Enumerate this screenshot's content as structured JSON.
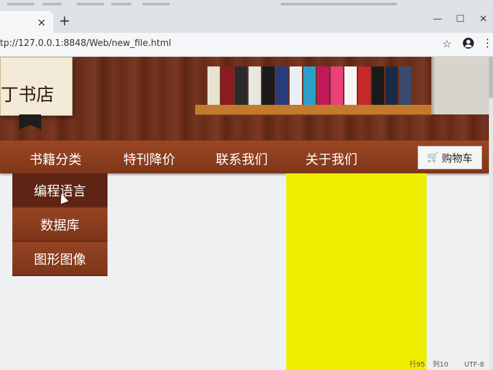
{
  "browser": {
    "tab_close_glyph": "×",
    "new_tab_glyph": "+",
    "url": "tp://127.0.0.1:8848/Web/new_file.html",
    "window_controls": {
      "minimize": "—",
      "maximize": "☐",
      "close": "✕"
    }
  },
  "page": {
    "logo_text": "丁书店",
    "nav": {
      "items": [
        "书籍分类",
        "特刊降价",
        "联系我们",
        "关于我们"
      ],
      "cart_label": "购物车"
    },
    "dropdown": {
      "items": [
        "编程语言",
        "数据库",
        "图形图像"
      ],
      "active_index": 0
    },
    "colors": {
      "nav_brown": "#8e3f1f",
      "dropdown_active": "#5e2414",
      "highlight_yellow": "#f0ee00"
    }
  },
  "status_bar": {
    "text_left": "行95",
    "text_mid": "列10",
    "encoding": "UTF-8"
  }
}
